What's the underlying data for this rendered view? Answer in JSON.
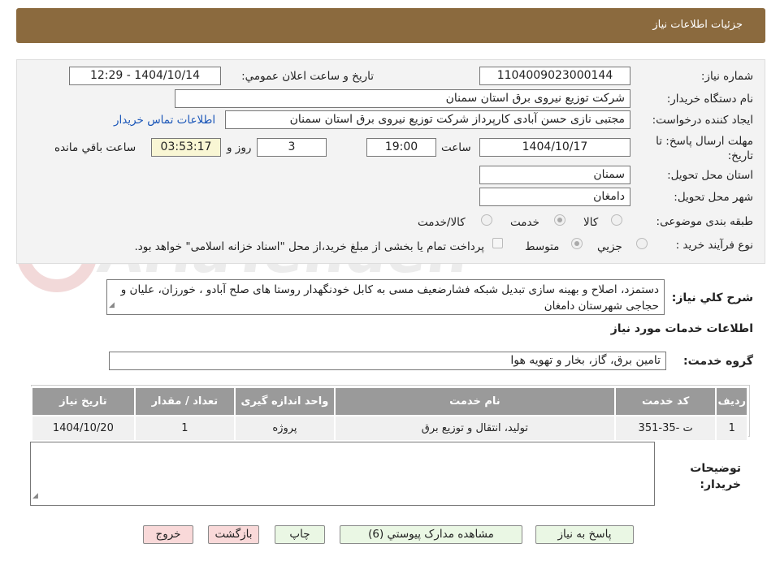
{
  "header": {
    "title": "جزئیات اطلاعات نیاز"
  },
  "form": {
    "need_number_label": "شماره نیاز:",
    "need_number": "1104009023000144",
    "announce_label": "تاریخ و ساعت اعلان عمومي:",
    "announce_value": "1404/10/14 - 12:29",
    "buyer_label": "نام دستگاه خریدار:",
    "buyer_value": "شرکت توزیع نیروی برق استان سمنان",
    "creator_label": "ایجاد کننده درخواست:",
    "creator_value": "مجتبی نازی حسن آبادی کارپرداز شرکت توزیع نیروی برق استان سمنان",
    "contact_link": "اطلاعات تماس خریدار",
    "deadline_label": "مهلت ارسال پاسخ: تا تاریخ:",
    "deadline_date": "1404/10/17",
    "time_label": "ساعت",
    "deadline_time": "19:00",
    "days_value": "3",
    "days_label": "روز و",
    "remaining_value": "03:53:17",
    "remaining_label": "ساعت باقي مانده",
    "province_label": "استان محل تحویل:",
    "province_value": "سمنان",
    "city_label": "شهر محل تحویل:",
    "city_value": "دامغان",
    "category_label": "طبقه بندی موضوعی:",
    "category_options": [
      "کالا",
      "خدمت",
      "کالا/خدمت"
    ],
    "category_selected": "خدمت",
    "process_label": "نوع فرآیند خرید :",
    "process_options": [
      "جزيي",
      "متوسط"
    ],
    "process_selected": "متوسط",
    "payment_note": "پرداخت تمام یا بخشی از مبلغ خرید،از محل \"اسناد خزانه اسلامی\" خواهد بود."
  },
  "description": {
    "label": "شرح کلي نیاز:",
    "text": "دستمزد، اصلاح و بهینه سازی تبدیل شبکه فشارضعیف مسی به کابل خودنگهدار روستا های صلح آبادو ، خورزان، علیان و حجاجی شهرستان دامغان"
  },
  "services": {
    "section_title": "اطلاعات خدمات مورد نیاز",
    "group_label": "گروه خدمت:",
    "group_value": "تامین برق، گاز، بخار و تهویه هوا",
    "columns": [
      "ردیف",
      "کد خدمت",
      "نام خدمت",
      "واحد اندازه گیری",
      "تعداد / مقدار",
      "تاریخ نیاز"
    ],
    "rows": [
      [
        "1",
        "ت -35-351",
        "تولید، انتقال و توزیع برق",
        "پروژه",
        "1",
        "1404/10/20"
      ]
    ]
  },
  "buyer_notes": {
    "label": "توضیحات خریدار:",
    "value": ""
  },
  "buttons": {
    "reply": "پاسخ به نیاز",
    "attachments": "مشاهده مدارک پیوستي (6)",
    "print": "چاپ",
    "back": "بازگشت",
    "exit": "خروج"
  },
  "colors": {
    "header": "#8b6a3e",
    "table_header": "#9a9a9a",
    "link": "#1a56b8"
  }
}
